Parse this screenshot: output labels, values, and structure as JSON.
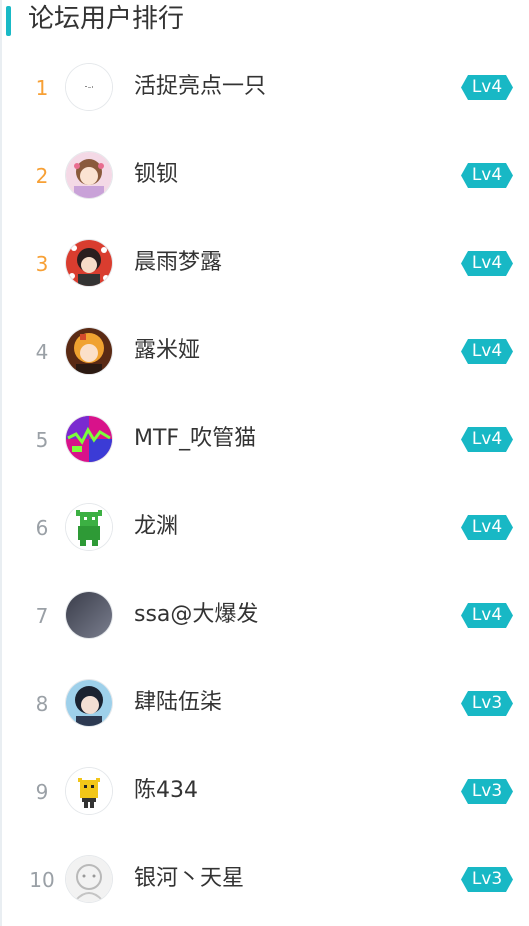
{
  "header": {
    "title": "论坛用户排行"
  },
  "colors": {
    "accent": "#19b9c6",
    "top_rank": "#f7a035",
    "rank": "#9aa0a6",
    "badge": "#18b8c5"
  },
  "users": [
    {
      "rank": "1",
      "name": "活捉亮点一只",
      "level": "Lv4"
    },
    {
      "rank": "2",
      "name": "钡钡",
      "level": "Lv4"
    },
    {
      "rank": "3",
      "name": "晨雨梦露",
      "level": "Lv4"
    },
    {
      "rank": "4",
      "name": "露米娅",
      "level": "Lv4"
    },
    {
      "rank": "5",
      "name": "MTF_吹管猫",
      "level": "Lv4"
    },
    {
      "rank": "6",
      "name": "龙渊",
      "level": "Lv4"
    },
    {
      "rank": "7",
      "name": "ssa@大爆发",
      "level": "Lv4"
    },
    {
      "rank": "8",
      "name": "肆陆伍柒",
      "level": "Lv3"
    },
    {
      "rank": "9",
      "name": "陈434",
      "level": "Lv3"
    },
    {
      "rank": "10",
      "name": "银河丶天星",
      "level": "Lv3"
    }
  ]
}
